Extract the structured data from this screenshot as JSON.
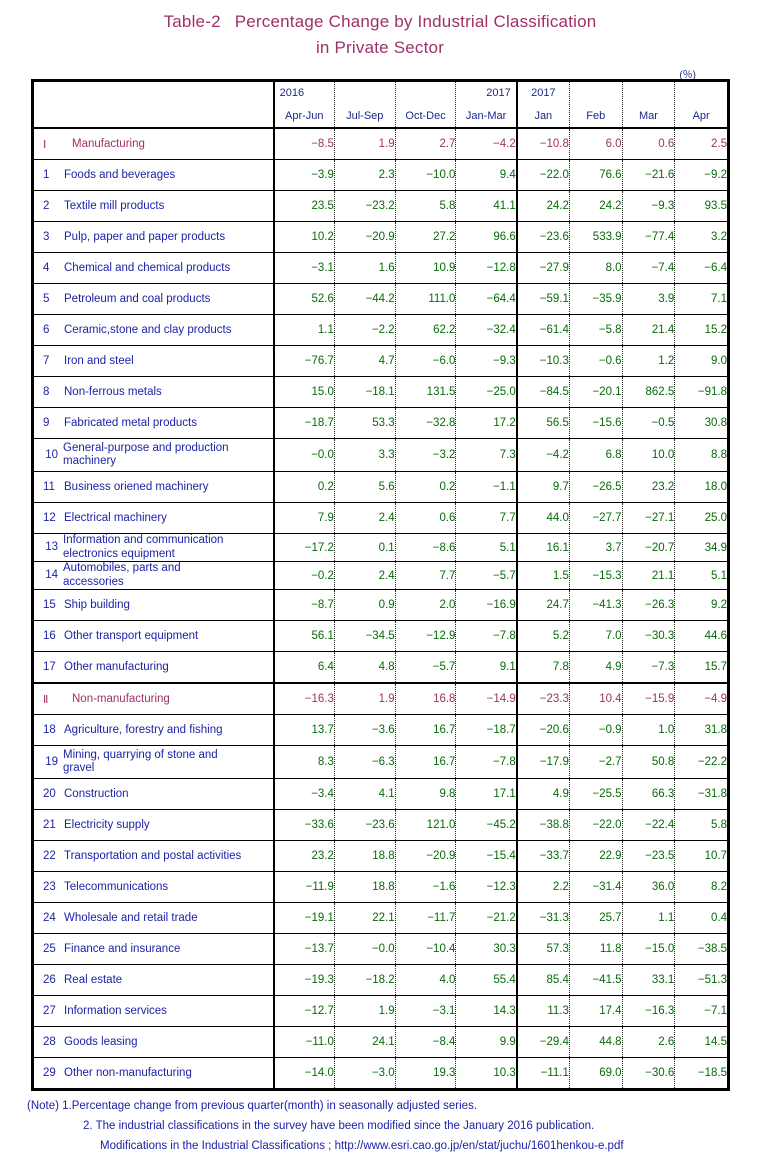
{
  "title": {
    "line1_prefix": "Table-2",
    "line1": "Percentage Change by Industrial Classification",
    "line2": "in Private Sector"
  },
  "unit": "(％)",
  "header": {
    "year_quarterly_start": "2016",
    "year_quarterly_end": "2017",
    "year_monthly": "2017",
    "periods": [
      "Apr-Jun",
      "Jul-Sep",
      "Oct-Dec",
      "Jan-Mar",
      "Jan",
      "Feb",
      "Mar",
      "Apr"
    ]
  },
  "chart_data": {
    "type": "table",
    "title": "Table-2 Percentage Change by Industrial Classification in Private Sector",
    "unit": "percent",
    "columns": [
      "2016 Apr-Jun",
      "2016 Jul-Sep",
      "2016 Oct-Dec",
      "2017 Jan-Mar",
      "2017 Jan",
      "2017 Feb",
      "2017 Mar",
      "2017 Apr"
    ],
    "rows": [
      {
        "num": "Ⅰ",
        "label": "Manufacturing",
        "section": true,
        "values": [
          "-8.5",
          "1.9",
          "2.7",
          "-4.2",
          "-10.8",
          "6.0",
          "0.6",
          "2.5"
        ]
      },
      {
        "num": "1",
        "label": "Foods and beverages",
        "values": [
          "-3.9",
          "2.3",
          "-10.0",
          "9.4",
          "-22.0",
          "76.6",
          "-21.6",
          "-9.2"
        ]
      },
      {
        "num": "2",
        "label": "Textile mill products",
        "values": [
          "23.5",
          "-23.2",
          "5.8",
          "41.1",
          "24.2",
          "24.2",
          "-9.3",
          "93.5"
        ]
      },
      {
        "num": "3",
        "label": "Pulp, paper and paper products",
        "values": [
          "10.2",
          "-20.9",
          "27.2",
          "96.6",
          "-23.6",
          "533.9",
          "-77.4",
          "3.2"
        ]
      },
      {
        "num": "4",
        "label": "Chemical and chemical products",
        "values": [
          "-3.1",
          "1.6",
          "10.9",
          "-12.8",
          "-27.9",
          "8.0",
          "-7.4",
          "-6.4"
        ]
      },
      {
        "num": "5",
        "label": "Petroleum and coal products",
        "values": [
          "52.6",
          "-44.2",
          "111.0",
          "-64.4",
          "-59.1",
          "-35.9",
          "3.9",
          "7.1"
        ]
      },
      {
        "num": "6",
        "label": "Ceramic,stone and clay products",
        "values": [
          "1.1",
          "-2.2",
          "62.2",
          "-32.4",
          "-61.4",
          "-5.8",
          "21.4",
          "15.2"
        ]
      },
      {
        "num": "7",
        "label": "Iron and steel",
        "values": [
          "-76.7",
          "4.7",
          "-6.0",
          "-9.3",
          "-10.3",
          "-0.6",
          "1.2",
          "9.0"
        ]
      },
      {
        "num": "8",
        "label": "Non-ferrous metals",
        "values": [
          "15.0",
          "-18.1",
          "131.5",
          "-25.0",
          "-84.5",
          "-20.1",
          "862.5",
          "-91.8"
        ]
      },
      {
        "num": "9",
        "label": "Fabricated metal products",
        "values": [
          "-18.7",
          "53.3",
          "-32.8",
          "17.2",
          "56.5",
          "-15.6",
          "-0.5",
          "30.8"
        ]
      },
      {
        "num": "10",
        "label_l1": "General-purpose and production",
        "label_l2": "machinery",
        "twoline": true,
        "values": [
          "-0.0",
          "3.3",
          "-3.2",
          "7.3",
          "-4.2",
          "6.8",
          "10.0",
          "8.8"
        ]
      },
      {
        "num": "11",
        "label": "Business oriened machinery",
        "values": [
          "0.2",
          "5.6",
          "0.2",
          "-1.1",
          "9.7",
          "-26.5",
          "23.2",
          "18.0"
        ]
      },
      {
        "num": "12",
        "label": "Electrical machinery",
        "values": [
          "7.9",
          "2.4",
          "0.6",
          "7.7",
          "44.0",
          "-27.7",
          "-27.1",
          "25.0"
        ]
      },
      {
        "num": "13",
        "label_l1": "Information and communication",
        "label_l2": "electronics equipment",
        "twoline": true,
        "tight": true,
        "values": [
          "-17.2",
          "0.1",
          "-8.6",
          "5.1",
          "16.1",
          "3.7",
          "-20.7",
          "34.9"
        ]
      },
      {
        "num": "14",
        "label_l1": "Automobiles, parts and",
        "label_l2": "accessories",
        "twoline": true,
        "tight": true,
        "values": [
          "-0.2",
          "2.4",
          "7.7",
          "-5.7",
          "1.5",
          "-15.3",
          "21.1",
          "5.1"
        ]
      },
      {
        "num": "15",
        "label": "Ship building",
        "values": [
          "-8.7",
          "0.9",
          "2.0",
          "-16.9",
          "24.7",
          "-41.3",
          "-26.3",
          "9.2"
        ]
      },
      {
        "num": "16",
        "label": "Other transport equipment",
        "values": [
          "56.1",
          "-34.5",
          "-12.9",
          "-7.8",
          "5.2",
          "7.0",
          "-30.3",
          "44.6"
        ]
      },
      {
        "num": "17",
        "label": "Other manufacturing",
        "values": [
          "6.4",
          "4.8",
          "-5.7",
          "9.1",
          "7.8",
          "4.9",
          "-7.3",
          "15.7"
        ]
      },
      {
        "num": "Ⅱ",
        "label": "Non-manufacturing",
        "section": true,
        "values": [
          "-16.3",
          "1.9",
          "16.8",
          "-14.9",
          "-23.3",
          "10.4",
          "-15.9",
          "-4.9"
        ]
      },
      {
        "num": "18",
        "label": "Agriculture, forestry and fishing",
        "values": [
          "13.7",
          "-3.6",
          "16.7",
          "-18.7",
          "-20.6",
          "-0.9",
          "1.0",
          "31.8"
        ]
      },
      {
        "num": "19",
        "label_l1": "Mining, quarrying of stone and",
        "label_l2": "gravel",
        "twoline": true,
        "values": [
          "8.3",
          "-6.3",
          "16.7",
          "-7.8",
          "-17.9",
          "-2.7",
          "50.8",
          "-22.2"
        ]
      },
      {
        "num": "20",
        "label": "Construction",
        "values": [
          "-3.4",
          "4.1",
          "9.8",
          "17.1",
          "4.9",
          "-25.5",
          "66.3",
          "-31.8"
        ]
      },
      {
        "num": "21",
        "label": "Electricity supply",
        "values": [
          "-33.6",
          "-23.6",
          "121.0",
          "-45.2",
          "-38.8",
          "-22.0",
          "-22.4",
          "5.8"
        ]
      },
      {
        "num": "22",
        "label": "Transportation and postal activities",
        "values": [
          "23.2",
          "18.8",
          "-20.9",
          "-15.4",
          "-33.7",
          "22.9",
          "-23.5",
          "10.7"
        ]
      },
      {
        "num": "23",
        "label": "Telecommunications",
        "values": [
          "-11.9",
          "18.8",
          "-1.6",
          "-12.3",
          "2.2",
          "-31.4",
          "36.0",
          "8.2"
        ]
      },
      {
        "num": "24",
        "label": "Wholesale and retail trade",
        "values": [
          "-19.1",
          "22.1",
          "-11.7",
          "-21.2",
          "-31.3",
          "25.7",
          "1.1",
          "0.4"
        ]
      },
      {
        "num": "25",
        "label": "Finance and insurance",
        "values": [
          "-13.7",
          "-0.0",
          "-10.4",
          "30.3",
          "57.3",
          "11.8",
          "-15.0",
          "-38.5"
        ]
      },
      {
        "num": "26",
        "label": "Real estate",
        "values": [
          "-19.3",
          "-18.2",
          "4.0",
          "55.4",
          "85.4",
          "-41.5",
          "33.1",
          "-51.3"
        ]
      },
      {
        "num": "27",
        "label": "Information services",
        "values": [
          "-12.7",
          "1.9",
          "-3.1",
          "14.3",
          "11.3",
          "17.4",
          "-16.3",
          "-7.1"
        ]
      },
      {
        "num": "28",
        "label": "Goods leasing",
        "values": [
          "-11.0",
          "24.1",
          "-8.4",
          "9.9",
          "-29.4",
          "44.8",
          "2.6",
          "14.5"
        ]
      },
      {
        "num": "29",
        "label": "Other non-manufacturing",
        "values": [
          "-14.0",
          "-3.0",
          "19.3",
          "10.3",
          "-11.1",
          "69.0",
          "-30.6",
          "-18.5"
        ]
      }
    ]
  },
  "notes": {
    "note1": "(Note) 1.Percentage change from previous quarter(month) in seasonally adjusted series.",
    "note2": "2. The industrial classifications in the survey have been modified since  the January 2016 publication.",
    "note3": "Modifications in the Industrial Classifications ;   http://www.esri.cao.go.jp/en/stat/juchu/1601henkou-e.pdf"
  },
  "colors": {
    "title": "#A0306A",
    "section_text": "#A0306A",
    "label_text": "#1c23a8",
    "value_text": "#076B08",
    "section_value_text": "#9C3364",
    "header_text": "#1a2a8a"
  }
}
